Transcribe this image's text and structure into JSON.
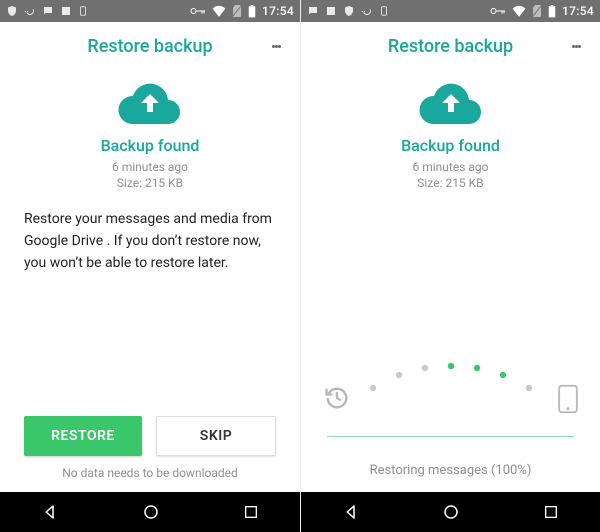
{
  "status": {
    "clock": "17:54"
  },
  "header": {
    "title": "Restore backup"
  },
  "backup": {
    "found_label": "Backup found",
    "age": "6 minutes ago",
    "size": "Size: 215 KB"
  },
  "left": {
    "explain": "Restore your messages and media from Google Drive . If you don’t restore now, you won’t be able to restore later.",
    "restore_btn": "RESTORE",
    "skip_btn": "SKIP",
    "footnote": "No data needs to be downloaded"
  },
  "right": {
    "progress_text": "Restoring messages (100%)"
  }
}
